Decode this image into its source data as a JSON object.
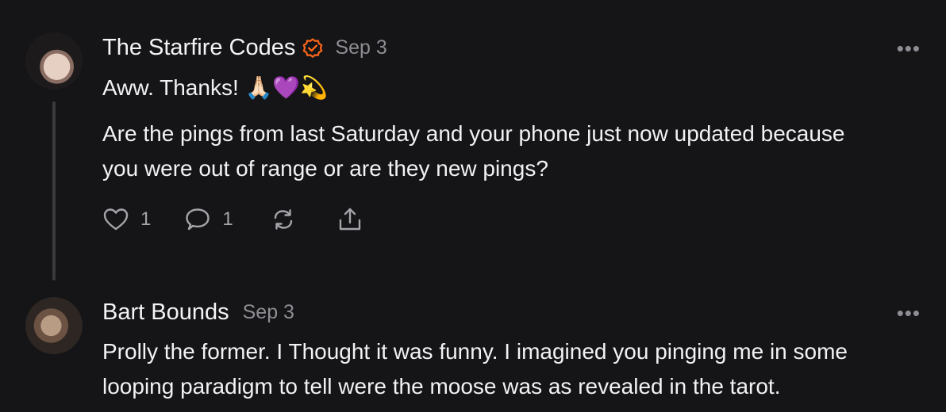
{
  "comments": [
    {
      "author": "The Starfire Codes",
      "verified_icon": "verified-badge-icon",
      "date": "Sep 3",
      "more_label": "•••",
      "paragraphs": [
        "Aww. Thanks! 🙏🏻💜💫",
        "Are the pings from last Saturday and your phone just now updated because",
        "you were out of range or are they new pings?"
      ],
      "likes": "1",
      "replies": "1",
      "accent_color": "#ff6719"
    },
    {
      "author": "Bart Bounds",
      "date": "Sep 3",
      "more_label": "•••",
      "paragraphs": [
        "Prolly the former. I Thought it was funny. I imagined you pinging me in some",
        "looping paradigm to tell were the moose was as revealed in the tarot."
      ]
    }
  ]
}
